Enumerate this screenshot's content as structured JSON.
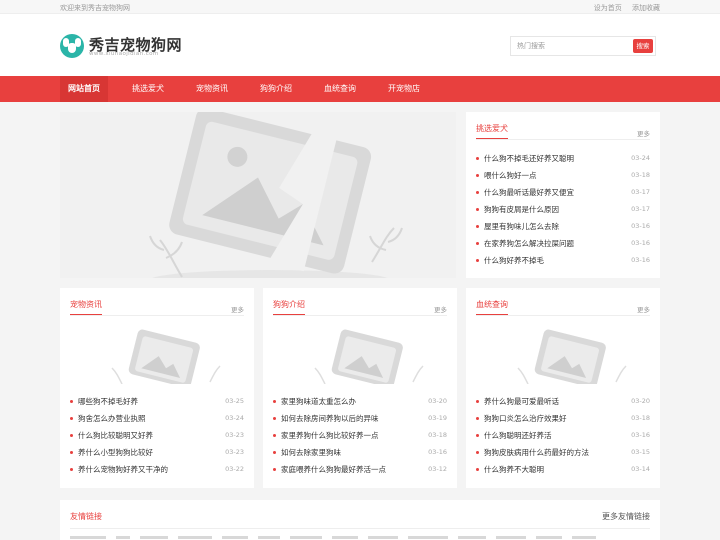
{
  "topbar": {
    "welcome": "欢迎来到秀吉宠物狗网",
    "set_home": "设为首页",
    "add_favorite": "添加收藏"
  },
  "header": {
    "site_name": "秀吉宠物狗网",
    "domain": "www.xiuhaojidian.com",
    "logo_color": "#2bb5a8"
  },
  "search": {
    "placeholder": "热门搜索",
    "button": "搜索"
  },
  "colors": {
    "accent": "#e8403e",
    "page_bg": "#f4f4f4"
  },
  "nav": {
    "items": [
      {
        "label": "网站首页",
        "active": true
      },
      {
        "label": "挑选爱犬",
        "active": false
      },
      {
        "label": "宠物资讯",
        "active": false
      },
      {
        "label": "狗狗介绍",
        "active": false
      },
      {
        "label": "血统查询",
        "active": false
      },
      {
        "label": "开宠物店",
        "active": false
      }
    ]
  },
  "banner": {
    "icon": "image-placeholder-icon"
  },
  "side_box": {
    "title": "挑选爱犬",
    "more": "更多",
    "items": [
      {
        "title": "什么狗不掉毛还好养又聪明",
        "date": "03-24"
      },
      {
        "title": "喂什么狗好一点",
        "date": "03-18"
      },
      {
        "title": "什么狗最听话最好养又便宜",
        "date": "03-17"
      },
      {
        "title": "狗狗有皮屑是什么原因",
        "date": "03-17"
      },
      {
        "title": "屋里有狗味儿怎么去除",
        "date": "03-16"
      },
      {
        "title": "在家养狗怎么解决拉屎问题",
        "date": "03-16"
      },
      {
        "title": "什么狗好养不掉毛",
        "date": "03-16"
      }
    ]
  },
  "box_pet_news": {
    "title": "宠物资讯",
    "more": "更多",
    "items": [
      {
        "title": "哪些狗不掉毛好养",
        "date": "03-25"
      },
      {
        "title": "狗舍怎么办营业执照",
        "date": "03-24"
      },
      {
        "title": "什么狗比较聪明又好养",
        "date": "03-23"
      },
      {
        "title": "养什么小型狗狗比较好",
        "date": "03-23"
      },
      {
        "title": "养什么宠物狗好养又干净的",
        "date": "03-22"
      }
    ]
  },
  "box_dog_intro": {
    "title": "狗狗介绍",
    "more": "更多",
    "items": [
      {
        "title": "家里狗味道太重怎么办",
        "date": "03-20"
      },
      {
        "title": "如何去除房间养狗以后的异味",
        "date": "03-19"
      },
      {
        "title": "家里养狗什么狗比较好养一点",
        "date": "03-18"
      },
      {
        "title": "如何去除家里狗味",
        "date": "03-16"
      },
      {
        "title": "家庭喂养什么狗狗最好养活一点",
        "date": "03-12"
      }
    ]
  },
  "box_pedigree": {
    "title": "血统查询",
    "more": "更多",
    "items": [
      {
        "title": "养什么狗最可爱最听话",
        "date": "03-20"
      },
      {
        "title": "狗狗口炎怎么治疗效果好",
        "date": "03-18"
      },
      {
        "title": "什么狗聪明还好养活",
        "date": "03-16"
      },
      {
        "title": "狗狗皮肤病用什么药最好的方法",
        "date": "03-15"
      },
      {
        "title": "什么狗养不大聪明",
        "date": "03-14"
      }
    ]
  },
  "friends": {
    "title": "友情链接",
    "more": "更多友情链接"
  }
}
